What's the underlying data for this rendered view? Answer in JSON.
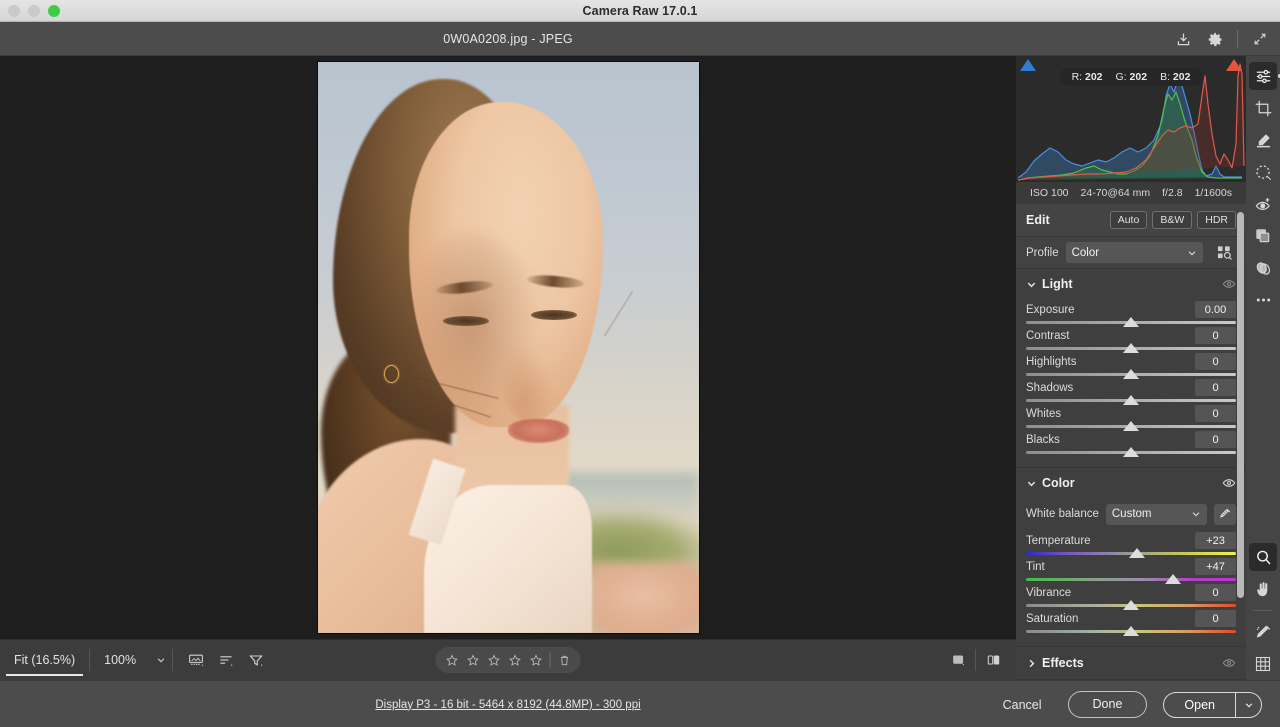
{
  "window": {
    "title": "Camera Raw 17.0.1",
    "traffic_lights": [
      "close",
      "minimize",
      "zoom"
    ]
  },
  "toolbar": {
    "file_title": "0W0A0208.jpg  -  JPEG",
    "buttons": [
      {
        "name": "save-image-icon",
        "label": "Save Image"
      },
      {
        "name": "preferences-gear-icon",
        "label": "Preferences"
      },
      {
        "name": "full-screen-icon",
        "label": "Full Screen"
      }
    ]
  },
  "histogram": {
    "readout": {
      "r_label": "R:",
      "r": "202",
      "g_label": "G:",
      "g": "202",
      "b_label": "B:",
      "b": "202"
    },
    "shadow_clip": "shadow-clipping-indicator",
    "highlight_clip": "highlight-clipping-indicator",
    "exif": {
      "iso": "ISO 100",
      "lens": "24-70@64 mm",
      "aperture": "f/2.8",
      "shutter": "1/1600s"
    }
  },
  "edit": {
    "title": "Edit",
    "buttons": [
      {
        "name": "auto-button",
        "label": "Auto"
      },
      {
        "name": "bw-button",
        "label": "B&W"
      },
      {
        "name": "hdr-button",
        "label": "HDR"
      }
    ],
    "profile": {
      "label": "Profile",
      "value": "Color",
      "browse_icon": "profile-browser-icon"
    }
  },
  "sections": {
    "light": {
      "title": "Light",
      "expanded": true,
      "sliders": [
        {
          "name": "exposure",
          "label": "Exposure",
          "value": "0.00",
          "pos": 50
        },
        {
          "name": "contrast",
          "label": "Contrast",
          "value": "0",
          "pos": 50
        },
        {
          "name": "highlights",
          "label": "Highlights",
          "value": "0",
          "pos": 50
        },
        {
          "name": "shadows",
          "label": "Shadows",
          "value": "0",
          "pos": 50
        },
        {
          "name": "whites",
          "label": "Whites",
          "value": "0",
          "pos": 50
        },
        {
          "name": "blacks",
          "label": "Blacks",
          "value": "0",
          "pos": 50
        }
      ]
    },
    "color": {
      "title": "Color",
      "expanded": true,
      "white_balance": {
        "label": "White balance",
        "value": "Custom",
        "picker_icon": "white-balance-eyedropper-icon"
      },
      "sliders": [
        {
          "name": "temperature",
          "label": "Temperature",
          "value": "+23",
          "pos": 53,
          "grad": "g-temp"
        },
        {
          "name": "tint",
          "label": "Tint",
          "value": "+47",
          "pos": 70,
          "grad": "g-tint"
        },
        {
          "name": "vibrance",
          "label": "Vibrance",
          "value": "0",
          "pos": 50,
          "grad": "g-vib"
        },
        {
          "name": "saturation",
          "label": "Saturation",
          "value": "0",
          "pos": 50,
          "grad": "g-sat"
        }
      ]
    },
    "effects": {
      "title": "Effects",
      "expanded": false
    }
  },
  "rail": {
    "top_tools": [
      {
        "name": "edit-tool-icon",
        "label": "Edit",
        "selected": true
      },
      {
        "name": "crop-tool-icon",
        "label": "Crop & Rotate",
        "selected": false
      },
      {
        "name": "healing-tool-icon",
        "label": "Remove",
        "selected": false
      },
      {
        "name": "masking-tool-icon",
        "label": "Masking",
        "selected": false
      },
      {
        "name": "red-eye-tool-icon",
        "label": "Red Eye",
        "selected": false
      },
      {
        "name": "presets-tool-icon",
        "label": "Presets",
        "selected": false
      },
      {
        "name": "snapshots-tool-icon",
        "label": "Snapshots",
        "selected": false
      },
      {
        "name": "more-options-icon",
        "label": "More Image Settings",
        "selected": false
      }
    ],
    "bottom_tools": [
      {
        "name": "zoom-tool-icon",
        "label": "Zoom",
        "selected": true
      },
      {
        "name": "hand-tool-icon",
        "label": "Hand",
        "selected": false
      },
      {
        "name": "eyedropper-tool-icon",
        "label": "Color Sampler",
        "selected": false
      },
      {
        "name": "grid-overlay-icon",
        "label": "Grid",
        "selected": false
      }
    ]
  },
  "bottombar": {
    "zoom_fit": "Fit (16.5%)",
    "zoom_100": "100%",
    "zoom_chevron": "zoom-level-chevron-icon",
    "tools": [
      {
        "name": "filmstrip-toggle-icon",
        "label": "Filmstrip"
      },
      {
        "name": "sort-order-icon",
        "label": "Sort"
      },
      {
        "name": "filter-icon",
        "label": "Filter"
      }
    ],
    "rating": {
      "stars": 5,
      "filled": 0,
      "reject_icon": "trash-reject-icon"
    },
    "view_tools": [
      {
        "name": "single-view-icon",
        "label": "Single View"
      },
      {
        "name": "before-after-view-icon",
        "label": "Before / After"
      }
    ]
  },
  "statusbar": {
    "info": "Display P3 - 16 bit - 5464 x 8192 (44.8MP) - 300 ppi",
    "cancel": "Cancel",
    "done": "Done",
    "open": "Open",
    "open_chevron": "open-options-chevron-icon"
  },
  "colors": {
    "accent_red": "#e2553f",
    "accent_blue": "#2e7fd4",
    "panel_bg": "#3f3f3f",
    "canvas_bg": "#1e1e1e"
  }
}
